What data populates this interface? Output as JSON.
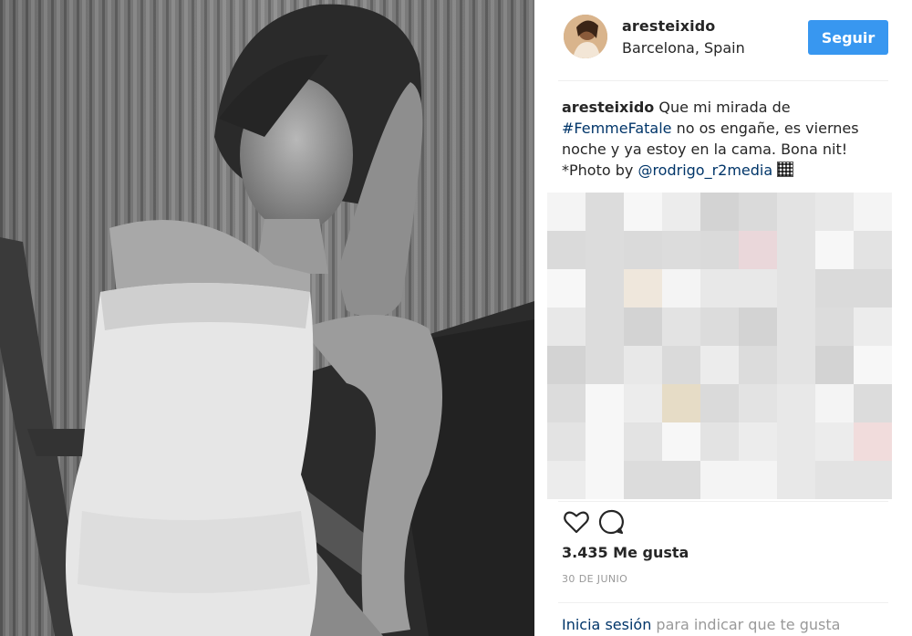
{
  "post": {
    "username": "aresteixido",
    "location": "Barcelona, Spain",
    "follow_label": "Seguir"
  },
  "caption": {
    "username": "aresteixido",
    "text_1": " Que mi mirada de ",
    "hashtag": "#FemmeFatale",
    "text_2": " no os engañe, es viernes noche y ya estoy en la cama. Bona nit! *Photo by ",
    "mention": "@rodrigo_r2media"
  },
  "icons": {
    "like": "heart-icon",
    "comment": "comment-bubble-icon",
    "emoji": "missing-glyph-icon"
  },
  "likes": "3.435 Me gusta",
  "date": "30 DE JUNIO",
  "login_prompt": {
    "link": "Inicia sesión",
    "text": " para indicar que te gusta"
  },
  "colors": {
    "follow_button": "#3897f0",
    "link": "#003569",
    "muted": "#999999"
  }
}
